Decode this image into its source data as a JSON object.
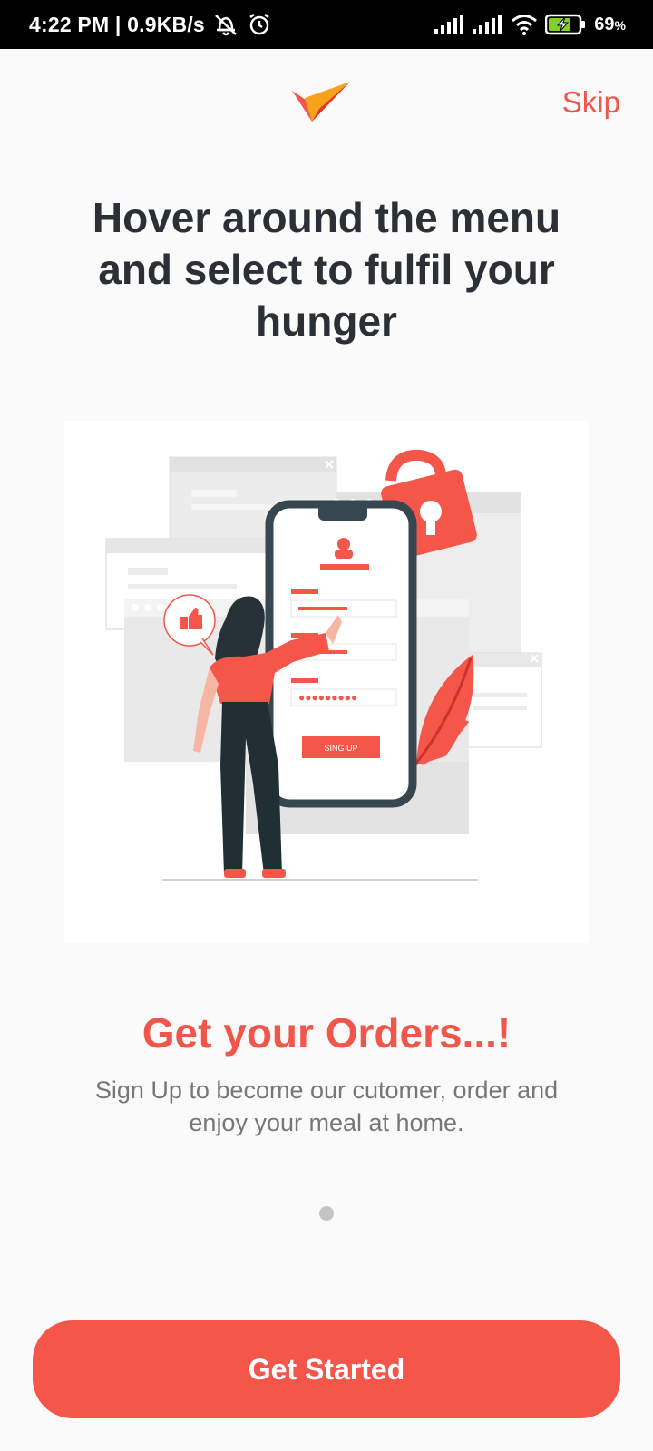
{
  "status_bar": {
    "time_speed": "4:22 PM | 0.9KB/s",
    "battery": "69",
    "battery_unit": "%"
  },
  "header": {
    "skip_label": "Skip"
  },
  "headline": "Hover around the menu and select to fulfil your hunger",
  "illustration": {
    "button_label": "SING UP"
  },
  "slide": {
    "title": "Get your Orders...!",
    "description": "Sign Up to become our cutomer, order and enjoy your meal at home."
  },
  "pager": {
    "count": 1,
    "active": 0
  },
  "cta": {
    "label": "Get Started"
  },
  "colors": {
    "accent": "#f5564a",
    "heading": "#2b2f36",
    "dark_teal": "#263238"
  }
}
